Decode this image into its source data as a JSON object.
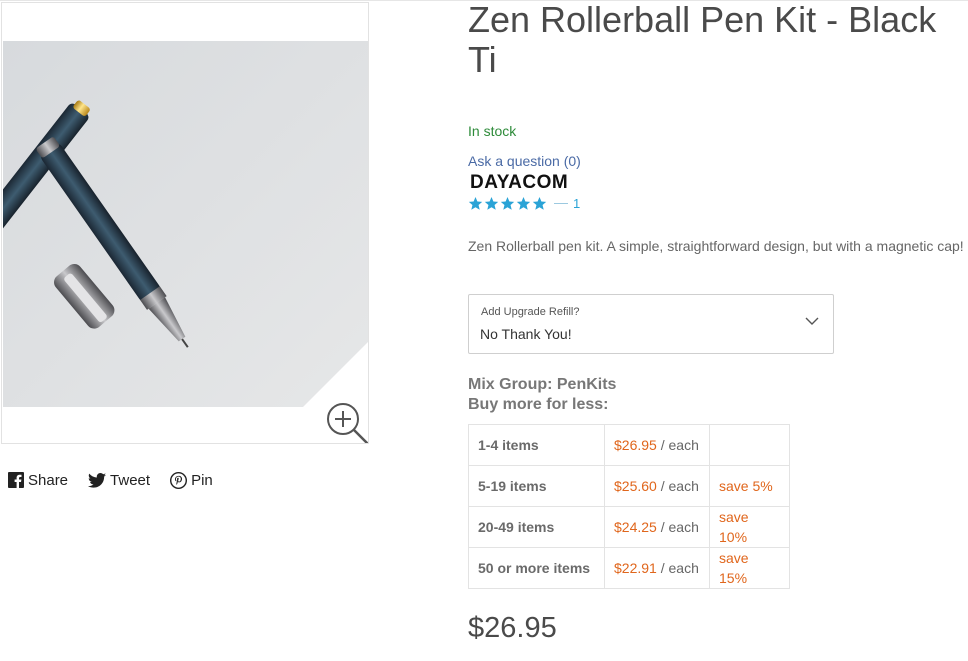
{
  "product": {
    "title": "Zen Rollerball Pen Kit - Black Ti",
    "stock_status": "In stock",
    "ask_question": "Ask a question (0)",
    "brand": "DAYACOM",
    "rating_stars": 5,
    "rating_count": "1",
    "description": "Zen Rollerball pen kit. A simple, straightforward design, but with a magnetic cap!",
    "price": "$26.95"
  },
  "upgrade_select": {
    "label": "Add Upgrade Refill?",
    "value": "No Thank You!"
  },
  "mix_group": {
    "line1": "Mix Group: PenKits",
    "line2": "Buy more for less:"
  },
  "tiers": [
    {
      "qty": "1-4 items",
      "price": "$26.95",
      "unit": " / each",
      "save": ""
    },
    {
      "qty": "5-19 items",
      "price": "$25.60",
      "unit": " / each",
      "save": "save 5%"
    },
    {
      "qty": "20-49 items",
      "price": "$24.25",
      "unit": " / each",
      "save": "save 10%"
    },
    {
      "qty": "50 or more items",
      "price": "$22.91",
      "unit": " / each",
      "save": "save 15%"
    }
  ],
  "share": {
    "facebook": "Share",
    "twitter": "Tweet",
    "pinterest": "Pin"
  },
  "colors": {
    "stock": "#2e8b3a",
    "link": "#4a6aa5",
    "star": "#2aa3d6",
    "accent_price": "#e0661c"
  }
}
